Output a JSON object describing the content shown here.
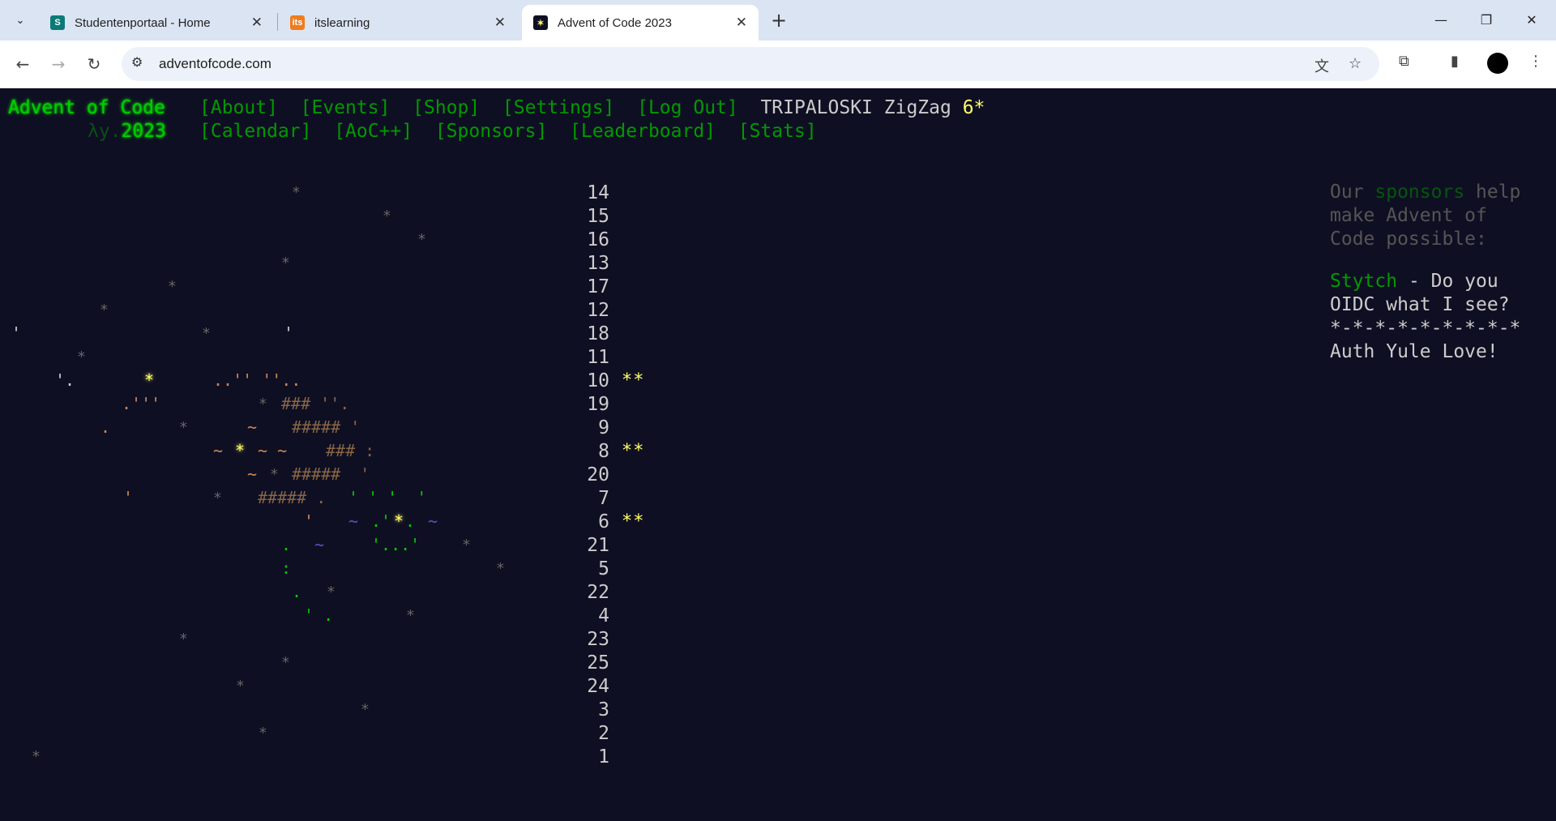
{
  "browser": {
    "tabs": [
      {
        "title": "Studentenportaal - Home",
        "favicon": "sharepoint-icon",
        "active": false
      },
      {
        "title": "itslearning",
        "favicon": "itslearning-icon",
        "active": false
      },
      {
        "title": "Advent of Code 2023",
        "favicon": "aoc-star-icon",
        "active": true
      }
    ],
    "url": "adventofcode.com"
  },
  "header": {
    "logo": "Advent of Code",
    "year_prefix": "λy.",
    "year": "2023",
    "nav_row1": [
      "[About]",
      "[Events]",
      "[Shop]",
      "[Settings]",
      "[Log Out]"
    ],
    "nav_row2": [
      "[Calendar]",
      "[AoC++]",
      "[Sponsors]",
      "[Leaderboard]",
      "[Stats]"
    ],
    "user": "TRIPALOSKI ZigZag",
    "star_count": "6*"
  },
  "calendar": {
    "days": [
      {
        "day": "14",
        "stars": ""
      },
      {
        "day": "15",
        "stars": ""
      },
      {
        "day": "16",
        "stars": ""
      },
      {
        "day": "13",
        "stars": ""
      },
      {
        "day": "17",
        "stars": ""
      },
      {
        "day": "12",
        "stars": ""
      },
      {
        "day": "18",
        "stars": ""
      },
      {
        "day": "11",
        "stars": ""
      },
      {
        "day": "10",
        "stars": "**"
      },
      {
        "day": "19",
        "stars": ""
      },
      {
        "day": "9",
        "stars": ""
      },
      {
        "day": "8",
        "stars": "**"
      },
      {
        "day": "20",
        "stars": ""
      },
      {
        "day": "7",
        "stars": ""
      },
      {
        "day": "6",
        "stars": "**"
      },
      {
        "day": "21",
        "stars": ""
      },
      {
        "day": "5",
        "stars": ""
      },
      {
        "day": "22",
        "stars": ""
      },
      {
        "day": "4",
        "stars": ""
      },
      {
        "day": "23",
        "stars": ""
      },
      {
        "day": "25",
        "stars": ""
      },
      {
        "day": "24",
        "stars": ""
      },
      {
        "day": "3",
        "stars": ""
      },
      {
        "day": "2",
        "stars": ""
      },
      {
        "day": "1",
        "stars": ""
      }
    ]
  },
  "sidebar": {
    "line1_pre": "Our ",
    "line1_link": "sponsors",
    "line1_post": " help",
    "line2": "make Advent of",
    "line3": "Code possible:",
    "sponsor_name": "Stytch",
    "sponsor_text1": " - Do you",
    "sponsor_text2": "OIDC what I see?",
    "sponsor_text3": "*-*-*-*-*-*-*-*-*",
    "sponsor_text4": "Auth Yule Love!"
  },
  "colors": {
    "background": "#0f0f23",
    "link_green": "#009900",
    "logo_green": "#00cc00",
    "star_yellow": "#ffff66",
    "text": "#cccccc"
  }
}
